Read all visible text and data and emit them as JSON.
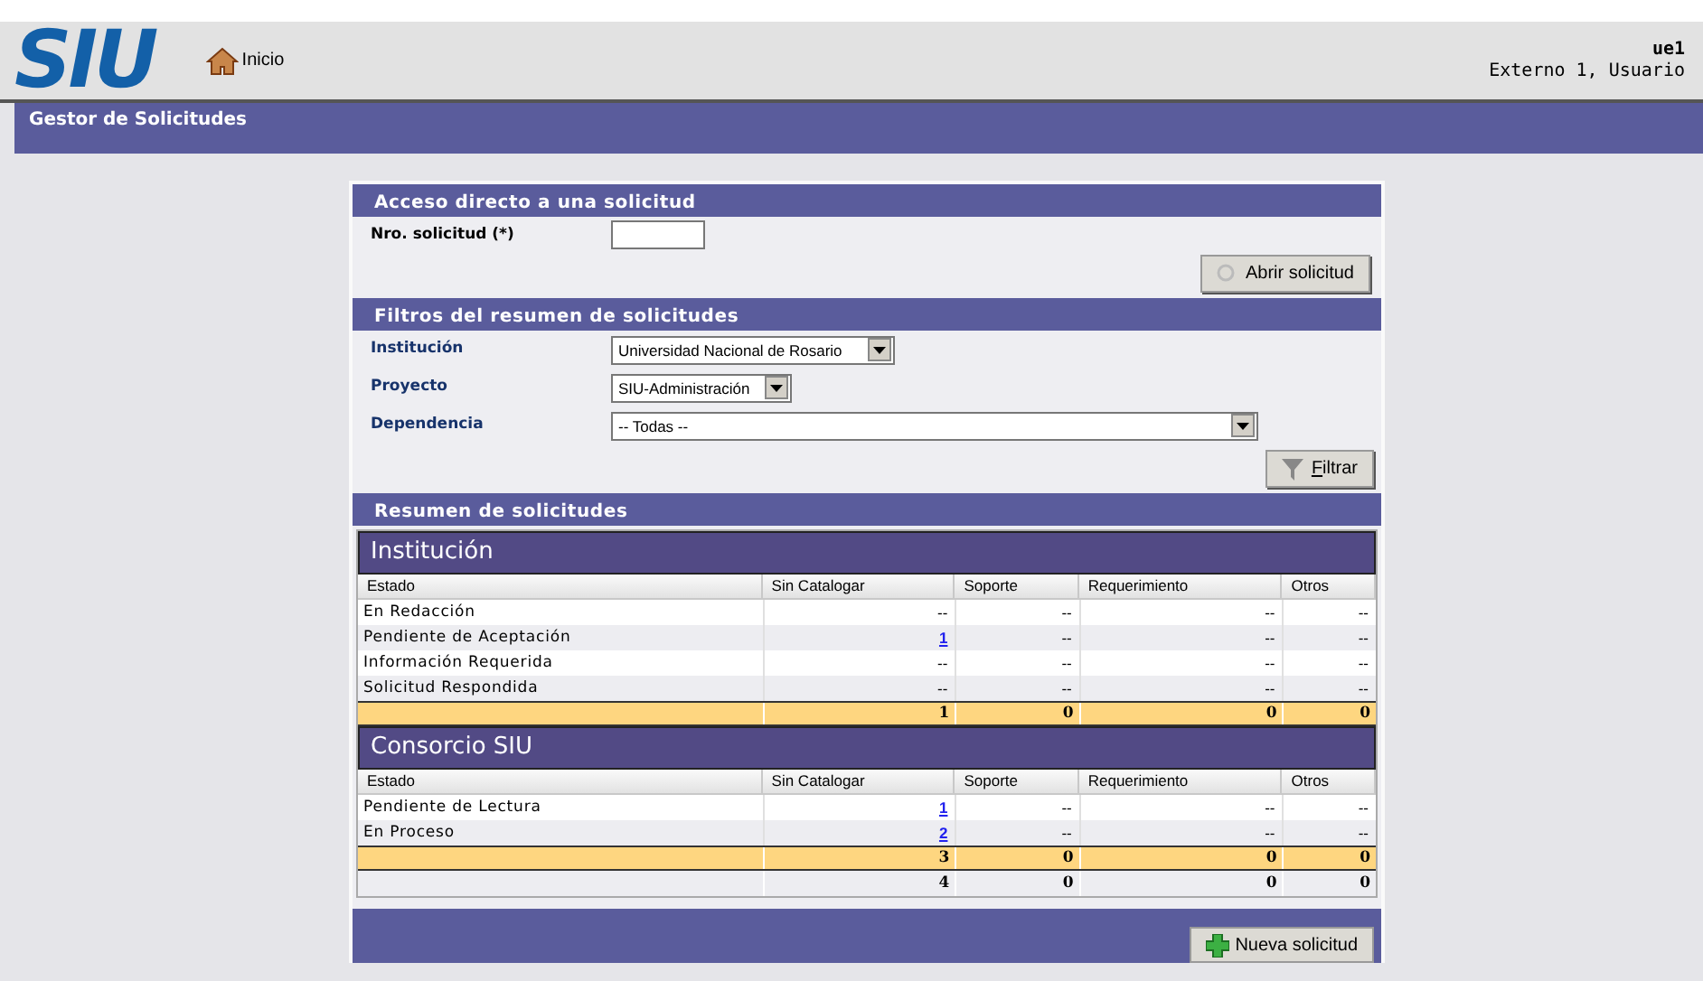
{
  "header": {
    "logo": "SIU",
    "home_link": "Inicio",
    "user_id": "ue1",
    "user_name": "Externo 1, Usuario"
  },
  "title_bar": "Gestor de Solicitudes",
  "direct_access": {
    "title": "Acceso directo a una solicitud",
    "label": "Nro. solicitud (*)",
    "button": "Abrir solicitud"
  },
  "filters": {
    "title": "Filtros del resumen de solicitudes",
    "fields": [
      {
        "label": "Institución",
        "value": "Universidad Nacional de Rosario"
      },
      {
        "label": "Proyecto",
        "value": "SIU-Administración"
      },
      {
        "label": "Dependencia",
        "value": "-- Todas --"
      }
    ],
    "button_accel": "F",
    "button_rest": "iltrar"
  },
  "summary": {
    "title": "Resumen de solicitudes",
    "groups": [
      {
        "name": "Institución",
        "columns": [
          "Estado",
          "Sin Catalogar",
          "Soporte",
          "Requerimiento",
          "Otros"
        ],
        "rows": [
          {
            "estado": "En Redacción",
            "cells": [
              {
                "text": "--",
                "kind": "plain"
              },
              {
                "text": "--",
                "kind": "plain"
              },
              {
                "text": "--",
                "kind": "plain"
              },
              {
                "text": "--",
                "kind": "plain"
              }
            ]
          },
          {
            "estado": "Pendiente de Aceptación",
            "cells": [
              {
                "text": "1",
                "kind": "link"
              },
              {
                "text": "--",
                "kind": "plain"
              },
              {
                "text": "--",
                "kind": "plain"
              },
              {
                "text": "--",
                "kind": "plain"
              }
            ]
          },
          {
            "estado": "Información Requerida",
            "cells": [
              {
                "text": "--",
                "kind": "plain"
              },
              {
                "text": "--",
                "kind": "plain"
              },
              {
                "text": "--",
                "kind": "plain"
              },
              {
                "text": "--",
                "kind": "plain"
              }
            ]
          },
          {
            "estado": "Solicitud Respondida",
            "cells": [
              {
                "text": "--",
                "kind": "plain"
              },
              {
                "text": "--",
                "kind": "plain"
              },
              {
                "text": "--",
                "kind": "plain"
              },
              {
                "text": "--",
                "kind": "plain"
              }
            ]
          }
        ],
        "totals": [
          "1",
          "0",
          "0",
          "0"
        ]
      },
      {
        "name": "Consorcio SIU",
        "columns": [
          "Estado",
          "Sin Catalogar",
          "Soporte",
          "Requerimiento",
          "Otros"
        ],
        "rows": [
          {
            "estado": "Pendiente de Lectura",
            "cells": [
              {
                "text": "1",
                "kind": "link"
              },
              {
                "text": "--",
                "kind": "plain"
              },
              {
                "text": "--",
                "kind": "plain"
              },
              {
                "text": "--",
                "kind": "plain"
              }
            ]
          },
          {
            "estado": "En Proceso",
            "cells": [
              {
                "text": "2",
                "kind": "link"
              },
              {
                "text": "--",
                "kind": "plain"
              },
              {
                "text": "--",
                "kind": "plain"
              },
              {
                "text": "--",
                "kind": "plain"
              }
            ]
          }
        ],
        "totals": [
          "3",
          "0",
          "0",
          "0"
        ]
      }
    ],
    "grand_totals": [
      "4",
      "0",
      "0",
      "0"
    ]
  },
  "new_button": "Nueva solicitud"
}
